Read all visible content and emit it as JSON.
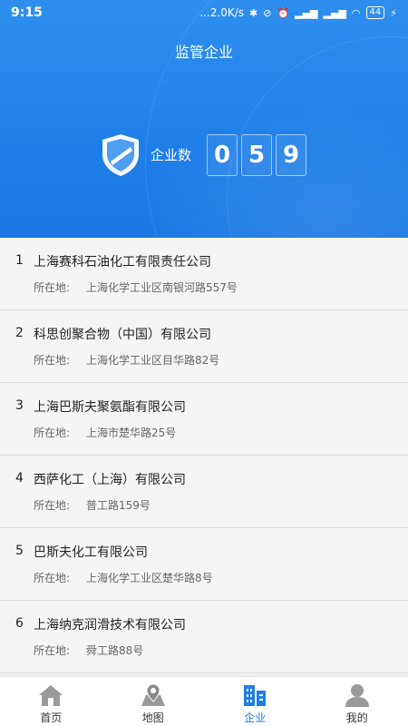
{
  "status_bar": {
    "time": "9:15",
    "network_speed": "...2.0K/s",
    "battery": "44"
  },
  "header": {
    "title": "监管企业",
    "count_label": "企业数",
    "count_digits": [
      "0",
      "5",
      "9"
    ]
  },
  "list": {
    "address_label": "所在地:",
    "items": [
      {
        "index": "1",
        "name": "上海赛科石油化工有限责任公司",
        "address": "上海化学工业区南银河路557号"
      },
      {
        "index": "2",
        "name": "科思创聚合物（中国）有限公司",
        "address": "上海化学工业区目华路82号"
      },
      {
        "index": "3",
        "name": "上海巴斯夫聚氨酯有限公司",
        "address": "上海市楚华路25号"
      },
      {
        "index": "4",
        "name": "西萨化工（上海）有限公司",
        "address": "普工路159号"
      },
      {
        "index": "5",
        "name": "巴斯夫化工有限公司",
        "address": "上海化学工业区楚华路8号"
      },
      {
        "index": "6",
        "name": "上海纳克润滑技术有限公司",
        "address": "舜工路88号"
      }
    ]
  },
  "tabbar": {
    "tabs": [
      {
        "label": "首页",
        "icon": "home-icon",
        "active": false
      },
      {
        "label": "地图",
        "icon": "map-icon",
        "active": false
      },
      {
        "label": "企业",
        "icon": "building-icon",
        "active": true
      },
      {
        "label": "我的",
        "icon": "user-icon",
        "active": false
      }
    ]
  },
  "colors": {
    "primary": "#1f7fe8",
    "inactive_icon": "#9a9a9a"
  }
}
